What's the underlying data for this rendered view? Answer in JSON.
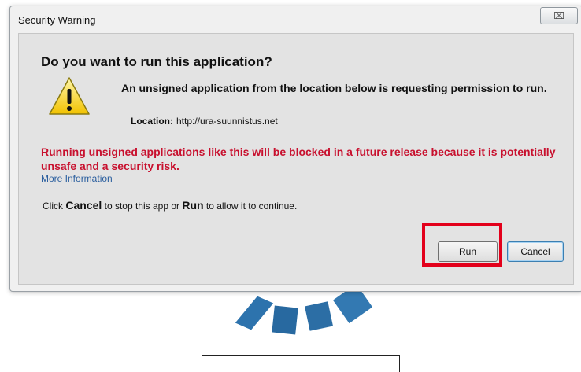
{
  "window": {
    "title": "Security Warning",
    "close_glyph": "⌧"
  },
  "dialog": {
    "heading": "Do you want to run this application?",
    "description": "An unsigned application from the location below is requesting permission to run.",
    "location_label": "Location:",
    "location_value": "http://ura-suunnistus.net",
    "warning": "Running unsigned applications like this will be blocked in a future release because it is potentially unsafe and a security risk.",
    "more_info": "More Information",
    "instruction": {
      "prefix": "Click",
      "cancel_word": "Cancel",
      "middle": "to stop this app or",
      "run_word": "Run",
      "suffix": "to allow it to continue."
    },
    "icon": "warning-triangle-icon"
  },
  "buttons": {
    "run": "Run",
    "cancel": "Cancel"
  },
  "colors": {
    "warning_text": "#c8102e",
    "link": "#2a5e9e",
    "highlight": "#e3001b"
  }
}
